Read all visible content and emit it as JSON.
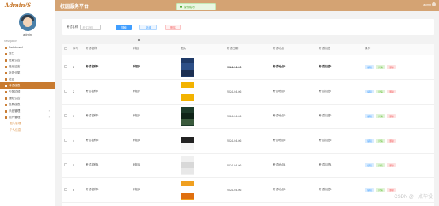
{
  "sidebar": {
    "brand": "Admin/S",
    "username": "admin",
    "nav_title": "Navigation",
    "items": [
      {
        "label": "Dashboard",
        "active": false
      },
      {
        "label": "学生",
        "active": false
      },
      {
        "label": "班级公告",
        "active": false
      },
      {
        "label": "班级留言",
        "active": false
      },
      {
        "label": "社团分类",
        "active": false
      },
      {
        "label": "社团",
        "active": false
      },
      {
        "label": "考试信息",
        "active": true
      },
      {
        "label": "失物招领",
        "active": false
      },
      {
        "label": "通知公告",
        "active": false
      },
      {
        "label": "投票信息",
        "active": false
      },
      {
        "label": "系统管理",
        "active": false,
        "caret": "›"
      },
      {
        "label": "用户管理",
        "active": false,
        "caret": "›"
      }
    ],
    "sub_items": [
      "图片管理",
      "个人信息"
    ]
  },
  "header": {
    "title": "校园服务平台",
    "user": "admin"
  },
  "toast": {
    "text": "操作成功"
  },
  "search": {
    "label": "考试名称",
    "placeholder": "考试名称",
    "search_button": "搜索",
    "add_button": "新增",
    "delete_button": "删除"
  },
  "table": {
    "columns": [
      "序号",
      "考试名称",
      "科目",
      "图片",
      "考试日期",
      "考试地点",
      "考试描述",
      "操作"
    ],
    "actions": {
      "edit": "编辑",
      "detail": "详情",
      "delete": "删除"
    },
    "rows": [
      {
        "index": "1",
        "name": "考试名称8",
        "subject": "科目8",
        "date": "2024-04-06",
        "place": "考试地点8",
        "desc": "考试描述8",
        "bold": true,
        "cover": [
          "#1f3a68",
          "#2d4f87",
          "#1c2f52"
        ]
      },
      {
        "index": "2",
        "name": "考试名称7",
        "subject": "科目7",
        "date": "2024-04-06",
        "place": "考试地点7",
        "desc": "考试描述7",
        "bold": false,
        "cover": [
          "#f3b300",
          "#ffffff",
          "#f3b300"
        ]
      },
      {
        "index": "3",
        "name": "考试名称6",
        "subject": "科目6",
        "date": "2024-04-06",
        "place": "考试地点6",
        "desc": "考试描述6",
        "bold": false,
        "cover": [
          "#1d3b2a",
          "#0f2418",
          "#3a5a3c"
        ]
      },
      {
        "index": "4",
        "name": "考试名称5",
        "subject": "科目5",
        "date": "2024-04-06",
        "place": "考试地点5",
        "desc": "考试描述5",
        "bold": false,
        "cover": [
          "#ffffff",
          "#222222",
          "#f5f5f5"
        ]
      },
      {
        "index": "5",
        "name": "考试名称4",
        "subject": "科目4",
        "date": "2024-04-06",
        "place": "考试地点4",
        "desc": "考试描述4",
        "bold": false,
        "cover": [
          "#f0f0f0",
          "#d8d8d8",
          "#e8e8e8"
        ]
      },
      {
        "index": "6",
        "name": "考试名称3",
        "subject": "科目3",
        "date": "2024-04-06",
        "place": "考试地点3",
        "desc": "考试描述3",
        "bold": false,
        "cover": [
          "#f0a020",
          "#ffffff",
          "#e07010"
        ]
      }
    ]
  },
  "watermark": "CSDN @一点毕设"
}
